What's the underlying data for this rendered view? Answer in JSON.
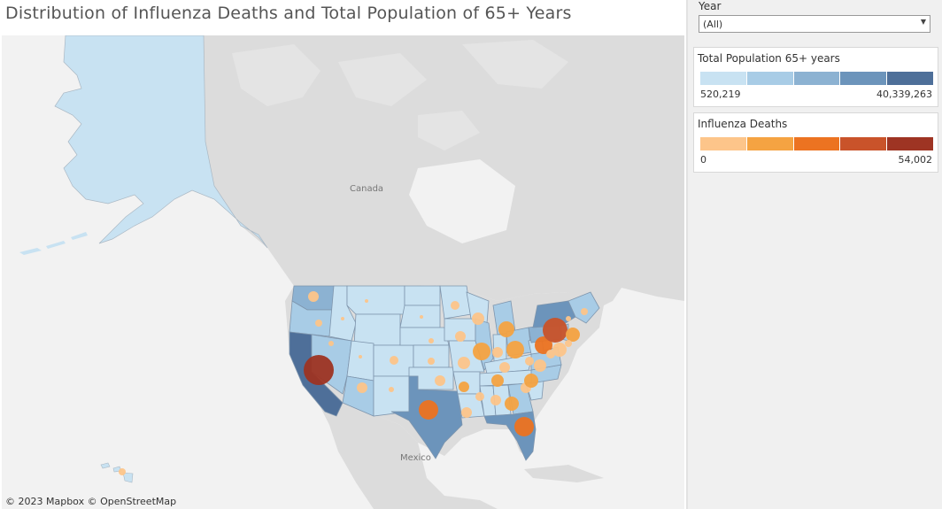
{
  "title": "Distribution of Influenza Deaths and Total Population of 65+ Years",
  "map": {
    "copyright": "© 2023 Mapbox  © OpenStreetMap",
    "labels": {
      "canada": "Canada",
      "mexico": "Mexico"
    }
  },
  "filter": {
    "label": "Year",
    "value": "(All)"
  },
  "legend_population": {
    "title": "Total Population 65+ years",
    "min": "520,219",
    "max": "40,339,263",
    "colors": [
      "#c8e2f2",
      "#a8cce6",
      "#8cb2d2",
      "#6c94bb",
      "#4e6f99"
    ]
  },
  "legend_deaths": {
    "title": "Influenza Deaths",
    "min": "0",
    "max": "54,002",
    "colors": [
      "#fdc58a",
      "#f5a342",
      "#ec7321",
      "#c9532a",
      "#9e3423"
    ]
  },
  "colors": {
    "land": "#dcdcdc",
    "water": "#f2f2f2",
    "state_light": "#c8e2f2",
    "state_mid": "#8cb2d2",
    "state_dark": "#4e6f99"
  }
}
